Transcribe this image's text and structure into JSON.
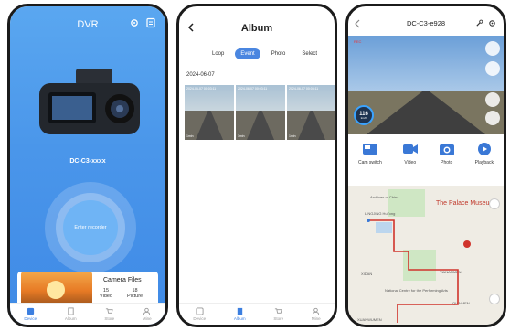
{
  "screen1": {
    "title": "DVR",
    "device_name": "DC-C3-xxxx",
    "record_button": "Enter recorder",
    "files": {
      "title": "Camera Files",
      "video_count": "15",
      "video_label": "Video",
      "picture_count": "18",
      "picture_label": "Picture"
    },
    "tabs": [
      {
        "label": "Device",
        "icon": "device-icon",
        "active": true
      },
      {
        "label": "Album",
        "icon": "album-icon",
        "active": false
      },
      {
        "label": "Store",
        "icon": "store-icon",
        "active": false
      },
      {
        "label": "Mine",
        "icon": "mine-icon",
        "active": false
      }
    ]
  },
  "screen2": {
    "title": "Album",
    "filters": [
      "Loop",
      "Event",
      "Photo"
    ],
    "active_filter": "Event",
    "select_label": "Select",
    "date": "2024-06-07",
    "thumbnails": [
      {
        "timestamp": "2024-06-07 00:03:11",
        "duration": "1min"
      },
      {
        "timestamp": "2024-06-07 00:03:11",
        "duration": "1min"
      },
      {
        "timestamp": "2024-06-07 00:03:11",
        "duration": "1min"
      }
    ],
    "tabs": [
      {
        "label": "Device"
      },
      {
        "label": "Album"
      },
      {
        "label": "Store"
      },
      {
        "label": "Mine"
      }
    ]
  },
  "screen3": {
    "title": "DC-C3-e928",
    "rec_label": "REC",
    "speed_value": "116",
    "speed_unit": "km/h",
    "actions": [
      {
        "label": "Cam switch",
        "icon": "cam-switch-icon"
      },
      {
        "label": "Video",
        "icon": "video-icon"
      },
      {
        "label": "Photo",
        "icon": "photo-icon"
      },
      {
        "label": "Playback",
        "icon": "playback-icon"
      }
    ],
    "map_labels": {
      "palace": "The Palace Museum",
      "area1": "LINGJING HuTong",
      "area2": "TIANANMEN",
      "area3": "National Centre for the Performing Arts",
      "area4": "XIDAN",
      "area5": "QIANMEN",
      "area6": "XUANWUMEN",
      "area7": "Archives of China"
    }
  },
  "colors": {
    "primary": "#3f8ae6",
    "accent": "#4a86e0",
    "route": "#d0342c"
  }
}
